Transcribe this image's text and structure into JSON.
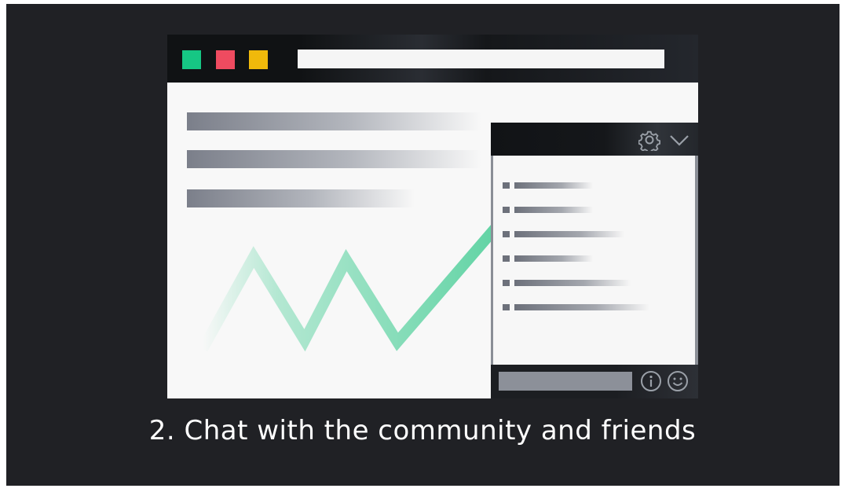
{
  "illustration": {
    "window_dots": [
      "green-dot",
      "red-dot",
      "yellow-dot"
    ],
    "colors": {
      "background": "#202125",
      "green": "#16c784",
      "red": "#ef4b60",
      "yellow": "#f0b90b",
      "chart_line": "#5fd3a3"
    },
    "chat_icons": [
      "gear-icon",
      "chevron-down-icon",
      "info-icon",
      "smile-icon"
    ],
    "chat_message_count": 6
  },
  "caption": "2. Chat with the community and friends"
}
